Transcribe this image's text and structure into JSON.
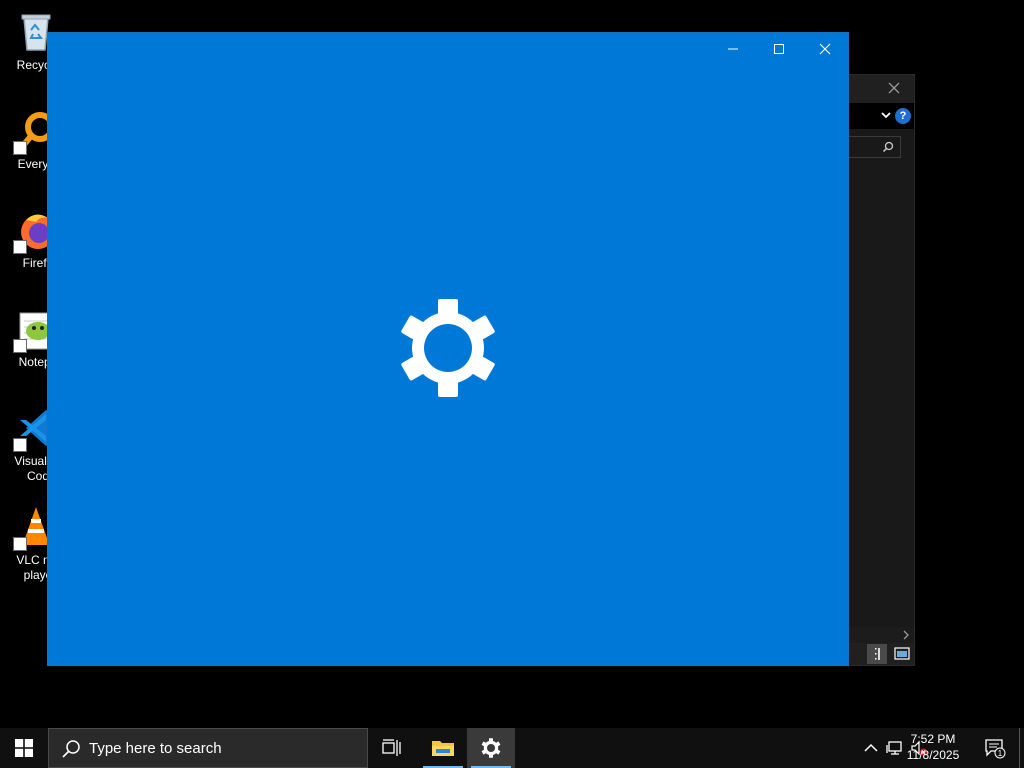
{
  "desktop": {
    "icons": [
      {
        "label": "Recycle",
        "icon": "recycle-bin-icon"
      },
      {
        "label": "Everyth",
        "icon": "everything-search-icon"
      },
      {
        "label": "Firefo",
        "icon": "firefox-icon"
      },
      {
        "label": "Notepa",
        "icon": "notepad-plus-plus-icon"
      },
      {
        "label": "Visual St\nCod",
        "icon": "vscode-icon"
      },
      {
        "label": "VLC me\nplaye",
        "icon": "vlc-icon"
      }
    ]
  },
  "settings_window": {
    "accent_color": "#0078d7",
    "splash_icon": "gear-icon",
    "caption_buttons": [
      "minimize-icon",
      "maximize-icon",
      "close-icon"
    ]
  },
  "taskbar": {
    "search_placeholder": "Type here to search",
    "time": "7:52 PM",
    "date": "11/8/2025",
    "notification_count": "1"
  }
}
